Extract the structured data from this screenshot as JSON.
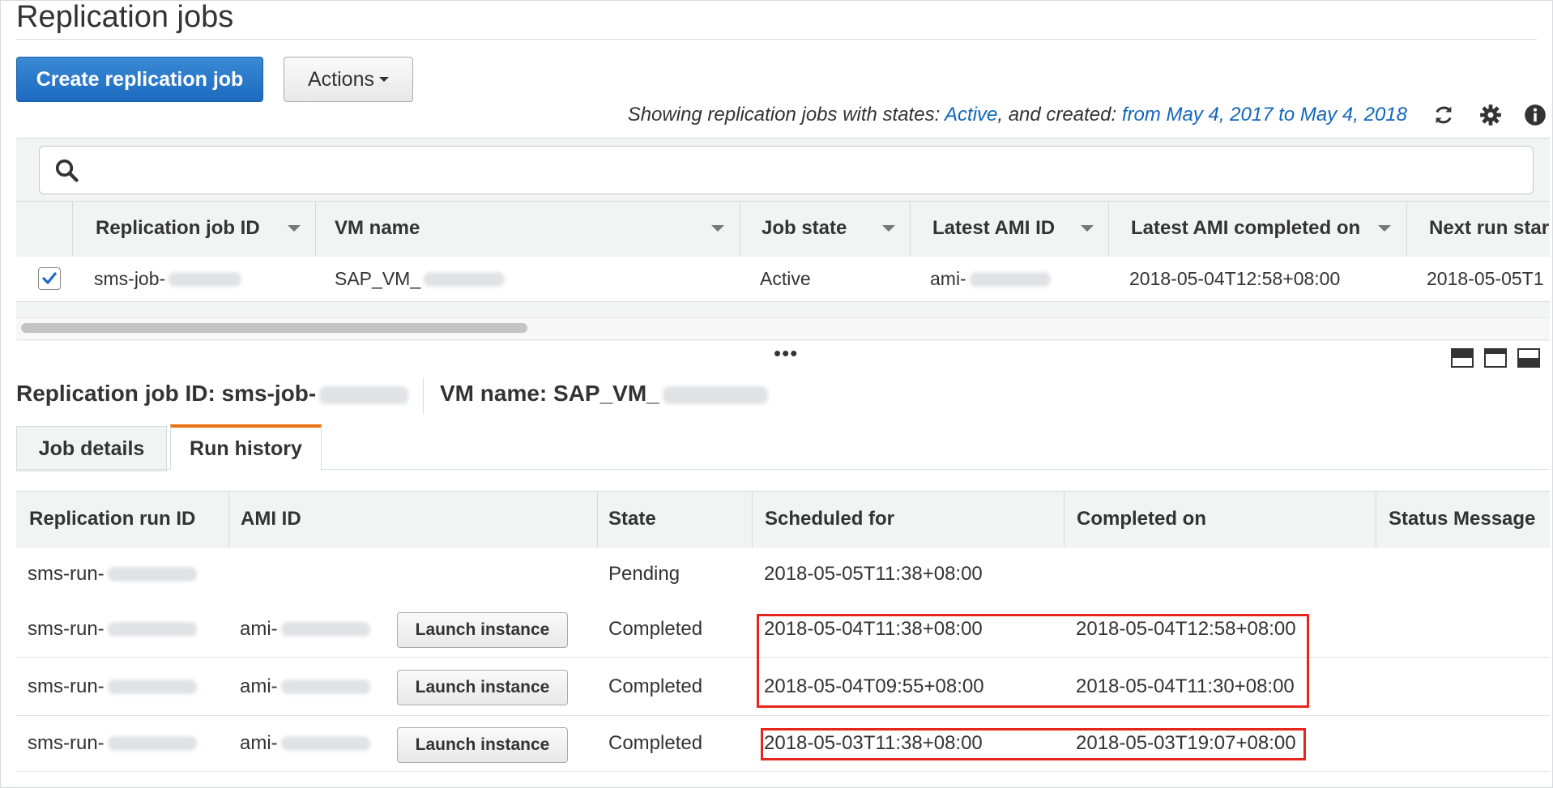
{
  "page": {
    "title": "Replication jobs"
  },
  "toolbar": {
    "create_label": "Create replication job",
    "actions_label": "Actions",
    "filter": {
      "prefix": "Showing replication jobs with states: ",
      "state": "Active",
      "middle": ", and created: ",
      "range": "from May 4, 2017 to May 4, 2018"
    },
    "icons": [
      "refresh-icon",
      "gear-icon",
      "info-icon"
    ]
  },
  "search": {
    "placeholder": ""
  },
  "jobs_table": {
    "columns": [
      "Replication job ID",
      "VM name",
      "Job state",
      "Latest AMI ID",
      "Latest AMI completed on",
      "Next run star"
    ],
    "rows": [
      {
        "checked": true,
        "job_id": "sms-job-",
        "vm_name": "SAP_VM_",
        "job_state": "Active",
        "latest_ami": "ami-",
        "completed_on": "2018-05-04T12:58+08:00",
        "next_run": "2018-05-05T1"
      }
    ]
  },
  "details": {
    "job_id_label": "Replication job ID: sms-job-",
    "vm_label": "VM name: SAP_VM_",
    "tabs": [
      "Job details",
      "Run history"
    ],
    "active_tab": "Run history"
  },
  "runs_table": {
    "columns": [
      "Replication run ID",
      "AMI ID",
      "State",
      "Scheduled for",
      "Completed on",
      "Status Message"
    ],
    "launch_label": "Launch instance",
    "rows": [
      {
        "run_id": "sms-run-",
        "ami": "",
        "state": "Pending",
        "scheduled": "2018-05-05T11:38+08:00",
        "completed": ""
      },
      {
        "run_id": "sms-run-",
        "ami": "ami-",
        "state": "Completed",
        "scheduled": "2018-05-04T11:38+08:00",
        "completed": "2018-05-04T12:58+08:00"
      },
      {
        "run_id": "sms-run-",
        "ami": "ami-",
        "state": "Completed",
        "scheduled": "2018-05-04T09:55+08:00",
        "completed": "2018-05-04T11:30+08:00"
      },
      {
        "run_id": "sms-run-",
        "ami": "ami-",
        "state": "Completed",
        "scheduled": "2018-05-03T11:38+08:00",
        "completed": "2018-05-03T19:07+08:00"
      }
    ]
  },
  "colors": {
    "primary": "#1c6ac0",
    "link": "#1166bb",
    "tab_accent": "#ec7211",
    "highlight": "#e8251c"
  }
}
